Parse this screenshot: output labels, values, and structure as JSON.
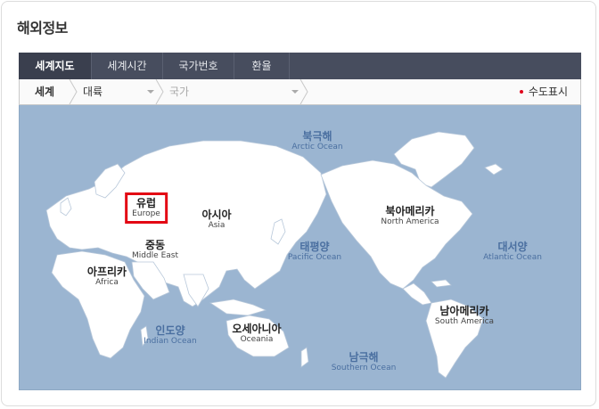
{
  "page": {
    "title": "해외정보"
  },
  "tabs": [
    {
      "label": "세계지도",
      "active": true
    },
    {
      "label": "세계시간",
      "active": false
    },
    {
      "label": "국가번호",
      "active": false
    },
    {
      "label": "환율",
      "active": false
    }
  ],
  "breadcrumb": {
    "root": "세계",
    "continent": "대륙",
    "country": "국가",
    "capital_toggle": "수도표시"
  },
  "map": {
    "continents": {
      "europe": {
        "ko": "유럽",
        "en": "Europe"
      },
      "asia": {
        "ko": "아시아",
        "en": "Asia"
      },
      "middle_east": {
        "ko": "중동",
        "en": "Middle East"
      },
      "africa": {
        "ko": "아프리카",
        "en": "Africa"
      },
      "oceania": {
        "ko": "오세아니아",
        "en": "Oceania"
      },
      "north_america": {
        "ko": "북아메리카",
        "en": "North America"
      },
      "south_america": {
        "ko": "남아메리카",
        "en": "South America"
      }
    },
    "oceans": {
      "arctic": {
        "ko": "북극해",
        "en": "Arctic Ocean"
      },
      "pacific": {
        "ko": "태평양",
        "en": "Pacific Ocean"
      },
      "atlantic": {
        "ko": "대서양",
        "en": "Atlantic Ocean"
      },
      "indian": {
        "ko": "인도양",
        "en": "Indian Ocean"
      },
      "southern": {
        "ko": "남극해",
        "en": "Southern Ocean"
      }
    },
    "colors": {
      "ocean": "#9bb5d1",
      "land": "#ffffff",
      "highlight": "#e30613"
    }
  }
}
